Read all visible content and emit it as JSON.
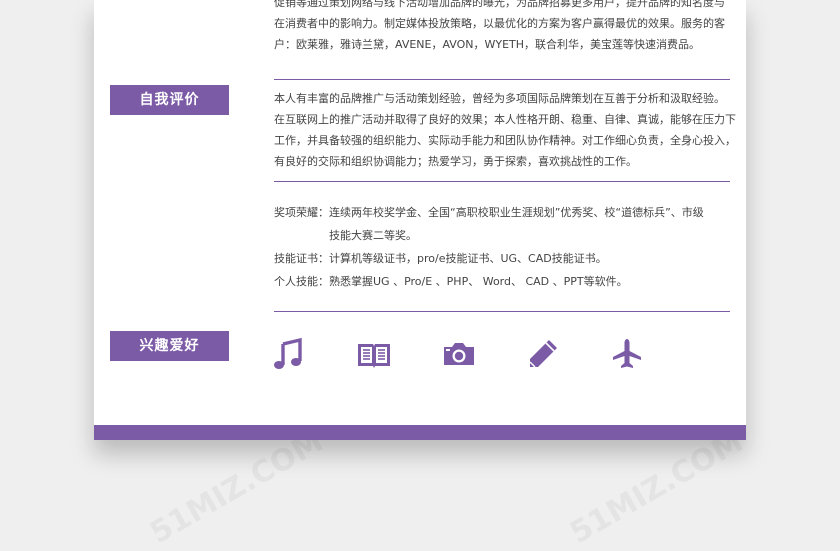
{
  "top_section": {
    "lines": [
      "促销等通过策划网络与线下活动增加品牌的曝光，为品牌招募更多用户，提升品牌的知名度与",
      "在消费者中的影响力。制定媒体投放策略，以最优化的方案为客户赢得最优的效果。服务的客",
      "户：欧莱雅，雅诗兰黛，AVENE，AVON，WYETH，联合利华，美宝莲等快速消费品。"
    ]
  },
  "self_eval": {
    "label": "自我评价",
    "lines": [
      "本人有丰富的品牌推广与活动策划经验，曾经为多项国际品牌策划在互善于分析和汲取经验。",
      "在互联网上的推广活动并取得了良好的效果；本人性格开朗、稳重、自律、真诚，能够在压力下",
      "工作，并具备较强的组织能力、实际动手能力和团队协作精神。对工作细心负责，全身心投入，",
      "有良好的交际和组织协调能力；热爱学习，勇于探索，喜欢挑战性的工作。"
    ]
  },
  "skills": {
    "awards_key": "奖项荣耀：",
    "awards_line1": "连续两年校奖学金、全国“高职校职业生涯规划”优秀奖、校“道德标兵”、市级",
    "awards_line2": "技能大赛二等奖。",
    "cert_key": "技能证书：",
    "cert_value": "计算机等级证书，pro/e技能证书、UG、CAD技能证书。",
    "personal_key": "个人技能：",
    "personal_value": "熟悉掌握UG 、Pro/E 、PHP、 Word、 CAD 、PPT等软件。"
  },
  "hobbies": {
    "label": "兴趣爱好",
    "icons": [
      "music-icon",
      "book-icon",
      "camera-icon",
      "pencil-icon",
      "airplane-icon"
    ]
  },
  "watermark": {
    "brand": "51MIZ.COM",
    "short": "51MIZ"
  },
  "colors": {
    "accent": "#7b5aa6",
    "page": "#ffffff",
    "background": "#efefef"
  }
}
